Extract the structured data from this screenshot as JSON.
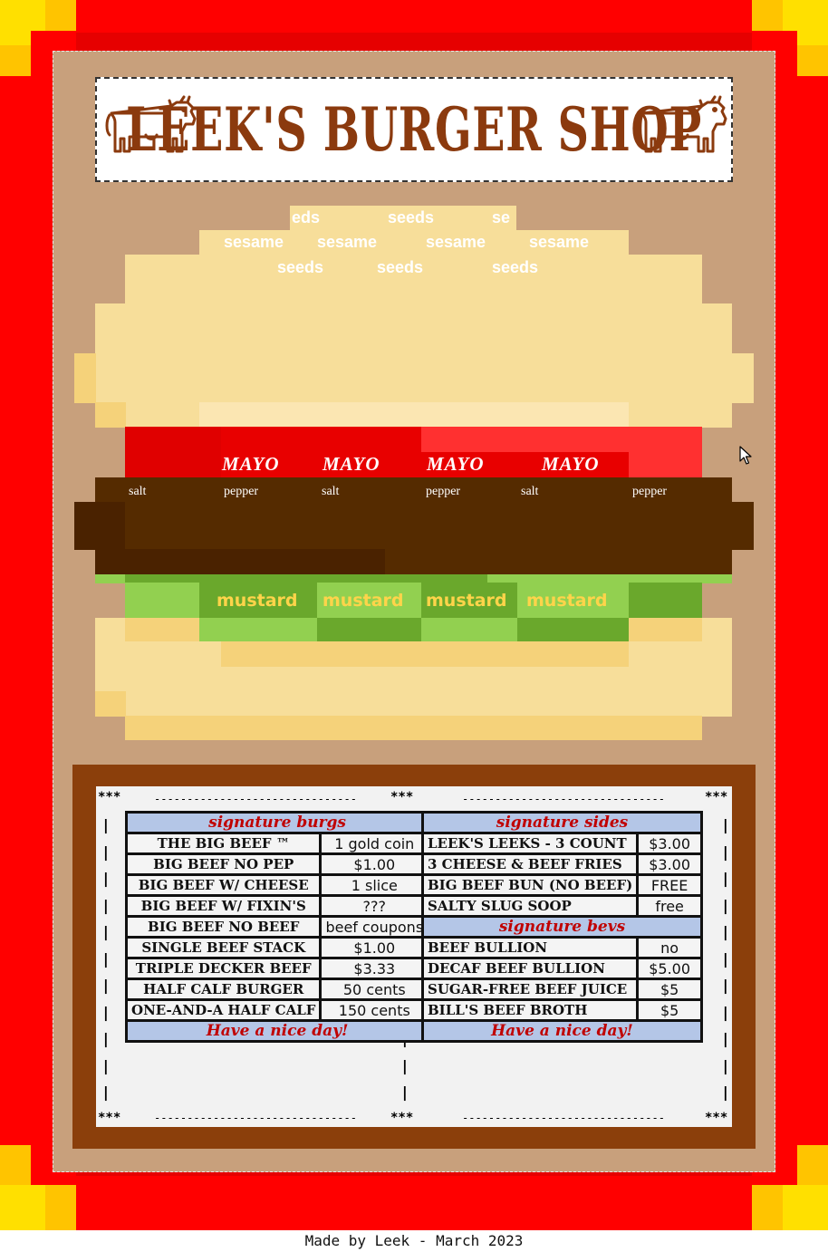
{
  "sign": {
    "title": "LEEK'S BURGER SHOP",
    "icons": [
      "cow-icon",
      "cow-icon"
    ]
  },
  "burger": {
    "seeds": [
      "eds",
      "seeds",
      "se",
      "sesame",
      "sesame",
      "sesame",
      "sesame",
      "seeds",
      "seeds",
      "seeds"
    ],
    "mayo": [
      "MAYO",
      "MAYO",
      "MAYO",
      "MAYO"
    ],
    "spices": [
      "salt",
      "pepper",
      "salt",
      "pepper",
      "salt",
      "pepper"
    ],
    "mustard": [
      "mustard",
      "mustard",
      "mustard",
      "mustard"
    ],
    "colors": {
      "bun": "#f7de9a",
      "tomato": "#e80000",
      "patty": "#552b00",
      "lettuce": "#92d050",
      "mustard": "#ffd44a"
    }
  },
  "menu": {
    "decor": {
      "stars": "***",
      "dashes": "----------------------------------",
      "pipe": "|"
    },
    "burgs": {
      "header": "signature burgs",
      "items": [
        {
          "name": "THE BIG BEEF ™",
          "price": "1 gold coin"
        },
        {
          "name": "BIG BEEF NO PEP",
          "price": "$1.00"
        },
        {
          "name": "BIG BEEF W/ CHEESE",
          "price": "1 slice"
        },
        {
          "name": "BIG BEEF W/ FIXIN'S",
          "price": "???"
        },
        {
          "name": "BIG BEEF NO BEEF",
          "price": "beef coupons"
        },
        {
          "name": "SINGLE BEEF STACK",
          "price": "$1.00"
        },
        {
          "name": "TRIPLE DECKER BEEF",
          "price": "$3.33"
        },
        {
          "name": "HALF CALF BURGER",
          "price": "50 cents"
        },
        {
          "name": "ONE-AND-A HALF CALF",
          "price": "150 cents"
        }
      ],
      "footer": "Have a nice day!"
    },
    "sides": {
      "header": "signature sides",
      "items": [
        {
          "name": "LEEK'S LEEKS - 3 COUNT",
          "price": "$3.00"
        },
        {
          "name": "3 CHEESE & BEEF FRIES",
          "price": "$3.00"
        },
        {
          "name": "BIG BEEF BUN (NO BEEF)",
          "price": "FREE"
        },
        {
          "name": "SALTY SLUG SOOP",
          "price": "free"
        }
      ]
    },
    "bevs": {
      "header": "signature bevs",
      "items": [
        {
          "name": "BEEF BULLION",
          "price": "no"
        },
        {
          "name": "DECAF BEEF BULLION",
          "price": "$5.00"
        },
        {
          "name": "SUGAR-FREE BEEF JUICE",
          "price": "$5"
        },
        {
          "name": "BILL'S BEEF BROTH",
          "price": "$5"
        }
      ],
      "footer": "Have a nice day!"
    }
  },
  "footer": {
    "credit": "Made by Leek - March 2023"
  }
}
